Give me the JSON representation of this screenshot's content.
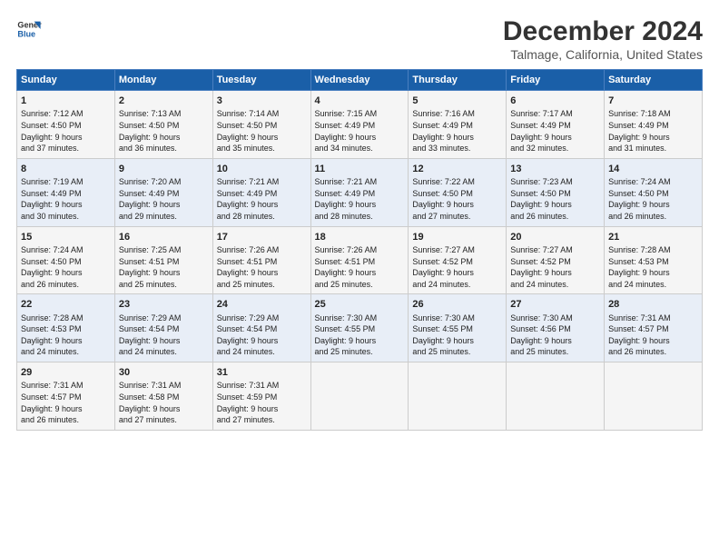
{
  "logo": {
    "line1": "General",
    "line2": "Blue"
  },
  "title": "December 2024",
  "subtitle": "Talmage, California, United States",
  "days_header": [
    "Sunday",
    "Monday",
    "Tuesday",
    "Wednesday",
    "Thursday",
    "Friday",
    "Saturday"
  ],
  "weeks": [
    [
      {
        "day": "1",
        "info": "Sunrise: 7:12 AM\nSunset: 4:50 PM\nDaylight: 9 hours\nand 37 minutes."
      },
      {
        "day": "2",
        "info": "Sunrise: 7:13 AM\nSunset: 4:50 PM\nDaylight: 9 hours\nand 36 minutes."
      },
      {
        "day": "3",
        "info": "Sunrise: 7:14 AM\nSunset: 4:50 PM\nDaylight: 9 hours\nand 35 minutes."
      },
      {
        "day": "4",
        "info": "Sunrise: 7:15 AM\nSunset: 4:49 PM\nDaylight: 9 hours\nand 34 minutes."
      },
      {
        "day": "5",
        "info": "Sunrise: 7:16 AM\nSunset: 4:49 PM\nDaylight: 9 hours\nand 33 minutes."
      },
      {
        "day": "6",
        "info": "Sunrise: 7:17 AM\nSunset: 4:49 PM\nDaylight: 9 hours\nand 32 minutes."
      },
      {
        "day": "7",
        "info": "Sunrise: 7:18 AM\nSunset: 4:49 PM\nDaylight: 9 hours\nand 31 minutes."
      }
    ],
    [
      {
        "day": "8",
        "info": "Sunrise: 7:19 AM\nSunset: 4:49 PM\nDaylight: 9 hours\nand 30 minutes."
      },
      {
        "day": "9",
        "info": "Sunrise: 7:20 AM\nSunset: 4:49 PM\nDaylight: 9 hours\nand 29 minutes."
      },
      {
        "day": "10",
        "info": "Sunrise: 7:21 AM\nSunset: 4:49 PM\nDaylight: 9 hours\nand 28 minutes."
      },
      {
        "day": "11",
        "info": "Sunrise: 7:21 AM\nSunset: 4:49 PM\nDaylight: 9 hours\nand 28 minutes."
      },
      {
        "day": "12",
        "info": "Sunrise: 7:22 AM\nSunset: 4:50 PM\nDaylight: 9 hours\nand 27 minutes."
      },
      {
        "day": "13",
        "info": "Sunrise: 7:23 AM\nSunset: 4:50 PM\nDaylight: 9 hours\nand 26 minutes."
      },
      {
        "day": "14",
        "info": "Sunrise: 7:24 AM\nSunset: 4:50 PM\nDaylight: 9 hours\nand 26 minutes."
      }
    ],
    [
      {
        "day": "15",
        "info": "Sunrise: 7:24 AM\nSunset: 4:50 PM\nDaylight: 9 hours\nand 26 minutes."
      },
      {
        "day": "16",
        "info": "Sunrise: 7:25 AM\nSunset: 4:51 PM\nDaylight: 9 hours\nand 25 minutes."
      },
      {
        "day": "17",
        "info": "Sunrise: 7:26 AM\nSunset: 4:51 PM\nDaylight: 9 hours\nand 25 minutes."
      },
      {
        "day": "18",
        "info": "Sunrise: 7:26 AM\nSunset: 4:51 PM\nDaylight: 9 hours\nand 25 minutes."
      },
      {
        "day": "19",
        "info": "Sunrise: 7:27 AM\nSunset: 4:52 PM\nDaylight: 9 hours\nand 24 minutes."
      },
      {
        "day": "20",
        "info": "Sunrise: 7:27 AM\nSunset: 4:52 PM\nDaylight: 9 hours\nand 24 minutes."
      },
      {
        "day": "21",
        "info": "Sunrise: 7:28 AM\nSunset: 4:53 PM\nDaylight: 9 hours\nand 24 minutes."
      }
    ],
    [
      {
        "day": "22",
        "info": "Sunrise: 7:28 AM\nSunset: 4:53 PM\nDaylight: 9 hours\nand 24 minutes."
      },
      {
        "day": "23",
        "info": "Sunrise: 7:29 AM\nSunset: 4:54 PM\nDaylight: 9 hours\nand 24 minutes."
      },
      {
        "day": "24",
        "info": "Sunrise: 7:29 AM\nSunset: 4:54 PM\nDaylight: 9 hours\nand 24 minutes."
      },
      {
        "day": "25",
        "info": "Sunrise: 7:30 AM\nSunset: 4:55 PM\nDaylight: 9 hours\nand 25 minutes."
      },
      {
        "day": "26",
        "info": "Sunrise: 7:30 AM\nSunset: 4:55 PM\nDaylight: 9 hours\nand 25 minutes."
      },
      {
        "day": "27",
        "info": "Sunrise: 7:30 AM\nSunset: 4:56 PM\nDaylight: 9 hours\nand 25 minutes."
      },
      {
        "day": "28",
        "info": "Sunrise: 7:31 AM\nSunset: 4:57 PM\nDaylight: 9 hours\nand 26 minutes."
      }
    ],
    [
      {
        "day": "29",
        "info": "Sunrise: 7:31 AM\nSunset: 4:57 PM\nDaylight: 9 hours\nand 26 minutes."
      },
      {
        "day": "30",
        "info": "Sunrise: 7:31 AM\nSunset: 4:58 PM\nDaylight: 9 hours\nand 27 minutes."
      },
      {
        "day": "31",
        "info": "Sunrise: 7:31 AM\nSunset: 4:59 PM\nDaylight: 9 hours\nand 27 minutes."
      },
      {
        "day": "",
        "info": ""
      },
      {
        "day": "",
        "info": ""
      },
      {
        "day": "",
        "info": ""
      },
      {
        "day": "",
        "info": ""
      }
    ]
  ]
}
